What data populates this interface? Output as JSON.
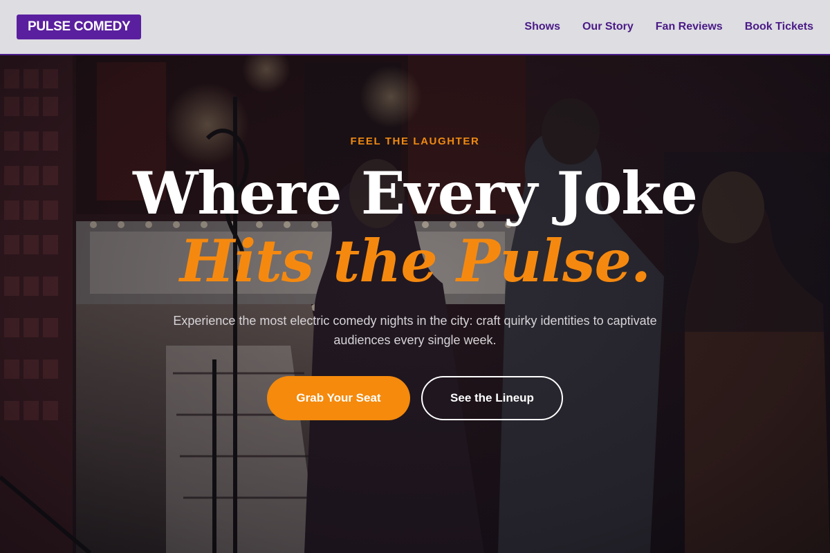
{
  "header": {
    "logo": "PULSE COMEDY",
    "nav": [
      {
        "label": "Shows"
      },
      {
        "label": "Our Story"
      },
      {
        "label": "Fan Reviews"
      },
      {
        "label": "Book Tickets"
      }
    ]
  },
  "hero": {
    "eyebrow": "FEEL THE LAUGHTER",
    "headline_line1": "Where Every Joke",
    "headline_line2": "Hits the Pulse.",
    "subtext": "Experience the most electric comedy nights in the city: craft quirky identities to captivate audiences every single week.",
    "primary_cta": "Grab Your Seat",
    "secondary_cta": "See the Lineup"
  },
  "colors": {
    "brand_purple": "#5a1f9e",
    "accent_orange": "#f58a0c",
    "nav_text": "#4a1a86"
  }
}
